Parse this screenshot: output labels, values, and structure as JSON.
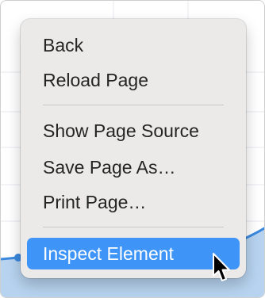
{
  "menu": {
    "items": [
      {
        "label": "Back"
      },
      {
        "label": "Reload Page"
      },
      {
        "label": "Show Page Source"
      },
      {
        "label": "Save Page As…"
      },
      {
        "label": "Print Page…"
      },
      {
        "label": "Inspect Element"
      }
    ],
    "highlighted_index": 5
  },
  "colors": {
    "highlight": "#3f95f7",
    "menu_background": "#ebeae9",
    "chart_fill": "#b7d3ef",
    "chart_line": "#3a89df"
  },
  "cursor": {
    "icon": "arrow-pointer-icon"
  }
}
